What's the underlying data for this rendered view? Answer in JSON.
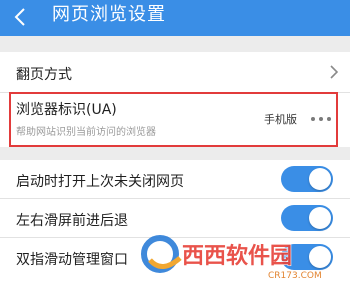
{
  "header": {
    "title": "网页浏览设置"
  },
  "rows": {
    "page_turn": {
      "label": "翻页方式"
    },
    "ua": {
      "title": "浏览器标识(UA)",
      "subtitle": "帮助网站识别当前访问的浏览器",
      "value": "手机版"
    },
    "restore": {
      "label": "启动时打开上次未关闭网页",
      "enabled": true
    },
    "swipe": {
      "label": "左右滑屏前进后退",
      "enabled": true
    },
    "two_finger": {
      "label": "双指滑动管理窗口",
      "enabled": true
    }
  },
  "watermark": {
    "brand": "西西软件园",
    "domain": "CR173.COM"
  },
  "colors": {
    "accent": "#3a8ee6",
    "highlight": "#e23b3b"
  }
}
